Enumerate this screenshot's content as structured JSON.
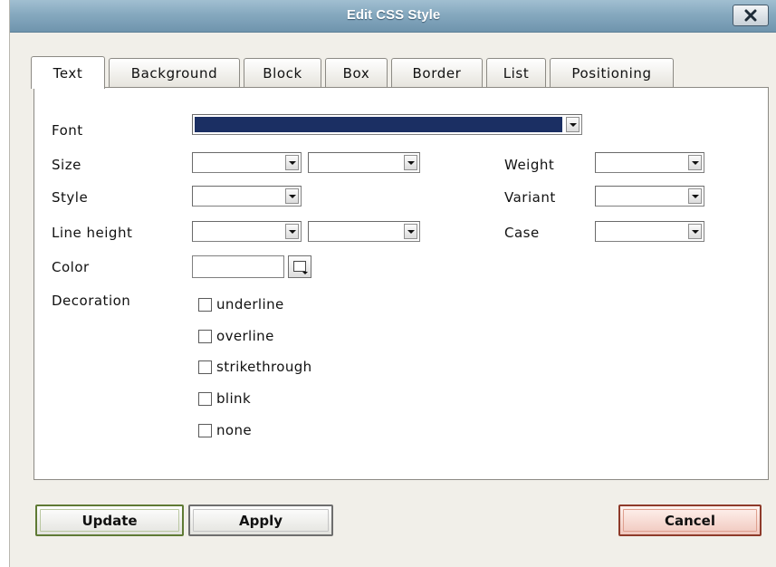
{
  "window": {
    "title": "Edit CSS Style",
    "close_icon": "close-x-icon"
  },
  "tabs": [
    {
      "label": "Text",
      "active": true
    },
    {
      "label": "Background",
      "active": false
    },
    {
      "label": "Block",
      "active": false
    },
    {
      "label": "Box",
      "active": false
    },
    {
      "label": "Border",
      "active": false
    },
    {
      "label": "List",
      "active": false
    },
    {
      "label": "Positioning",
      "active": false
    }
  ],
  "form": {
    "font_label": "Font",
    "font_value": "",
    "size_label": "Size",
    "style_label": "Style",
    "line_height_label": "Line height",
    "color_label": "Color",
    "color_value": "",
    "weight_label": "Weight",
    "variant_label": "Variant",
    "case_label": "Case",
    "decoration_label": "Decoration",
    "decorations": [
      {
        "label": "underline",
        "checked": false
      },
      {
        "label": "overline",
        "checked": false
      },
      {
        "label": "strikethrough",
        "checked": false
      },
      {
        "label": "blink",
        "checked": false
      },
      {
        "label": "none",
        "checked": false
      }
    ]
  },
  "buttons": {
    "update": "Update",
    "apply": "Apply",
    "cancel": "Cancel"
  },
  "colors": {
    "title_bar": "#86a9bf",
    "font_selection": "#1b2f63",
    "dialog_bg": "#f1efe9",
    "update_border": "#5f7a34",
    "cancel_bg": "#f0c7bd"
  }
}
